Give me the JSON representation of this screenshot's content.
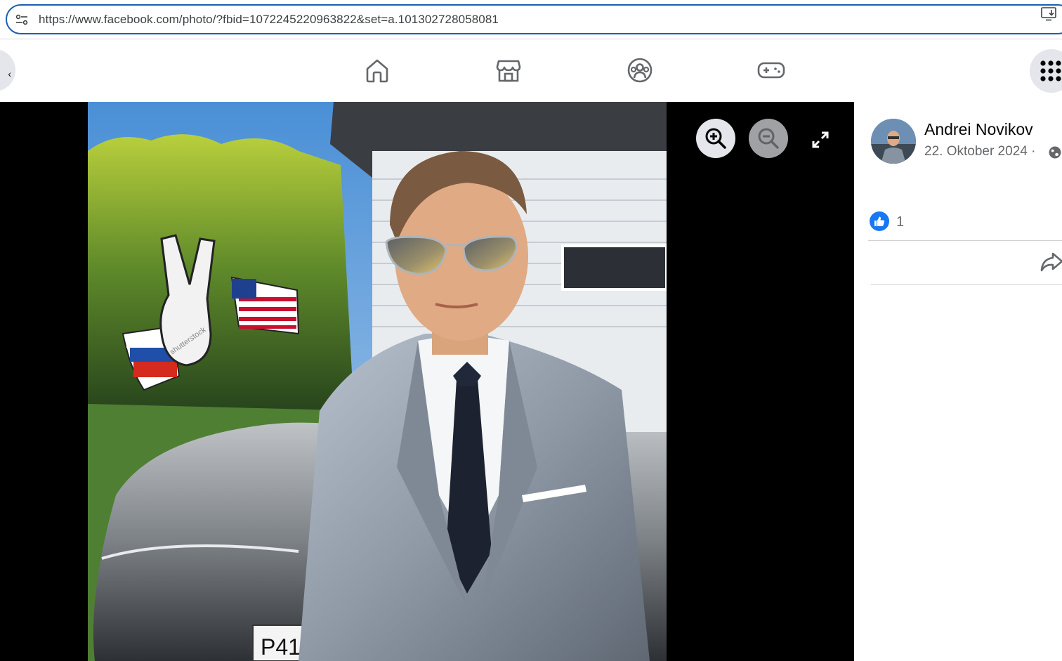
{
  "browser": {
    "url": "https://www.facebook.com/photo/?fbid=1072245220963822&set=a.101302728058081",
    "site_info_icon": "tune-icon",
    "install_icon": "install-app-icon"
  },
  "nav": {
    "icons": [
      "home-icon",
      "marketplace-icon",
      "groups-icon",
      "gaming-icon"
    ],
    "back_glyph": "‹",
    "menu_icon": "apps-grid-icon"
  },
  "viewer": {
    "controls": [
      "zoom-in-icon",
      "zoom-out-icon",
      "fullscreen-icon"
    ],
    "photo_watermark": "shutterstock",
    "plate_text": "P411"
  },
  "post": {
    "author_name": "Andrei Novikov",
    "date": "22. Oktober 2024 ·",
    "privacy_icon": "globe-icon",
    "like_count": "1",
    "reaction_icon": "like-icon",
    "share_icon": "share-icon"
  },
  "colors": {
    "accent": "#1877f2",
    "omnibox_border": "#1a5fb4",
    "nav_icon": "#65676b",
    "viewer_bg": "#000000"
  }
}
